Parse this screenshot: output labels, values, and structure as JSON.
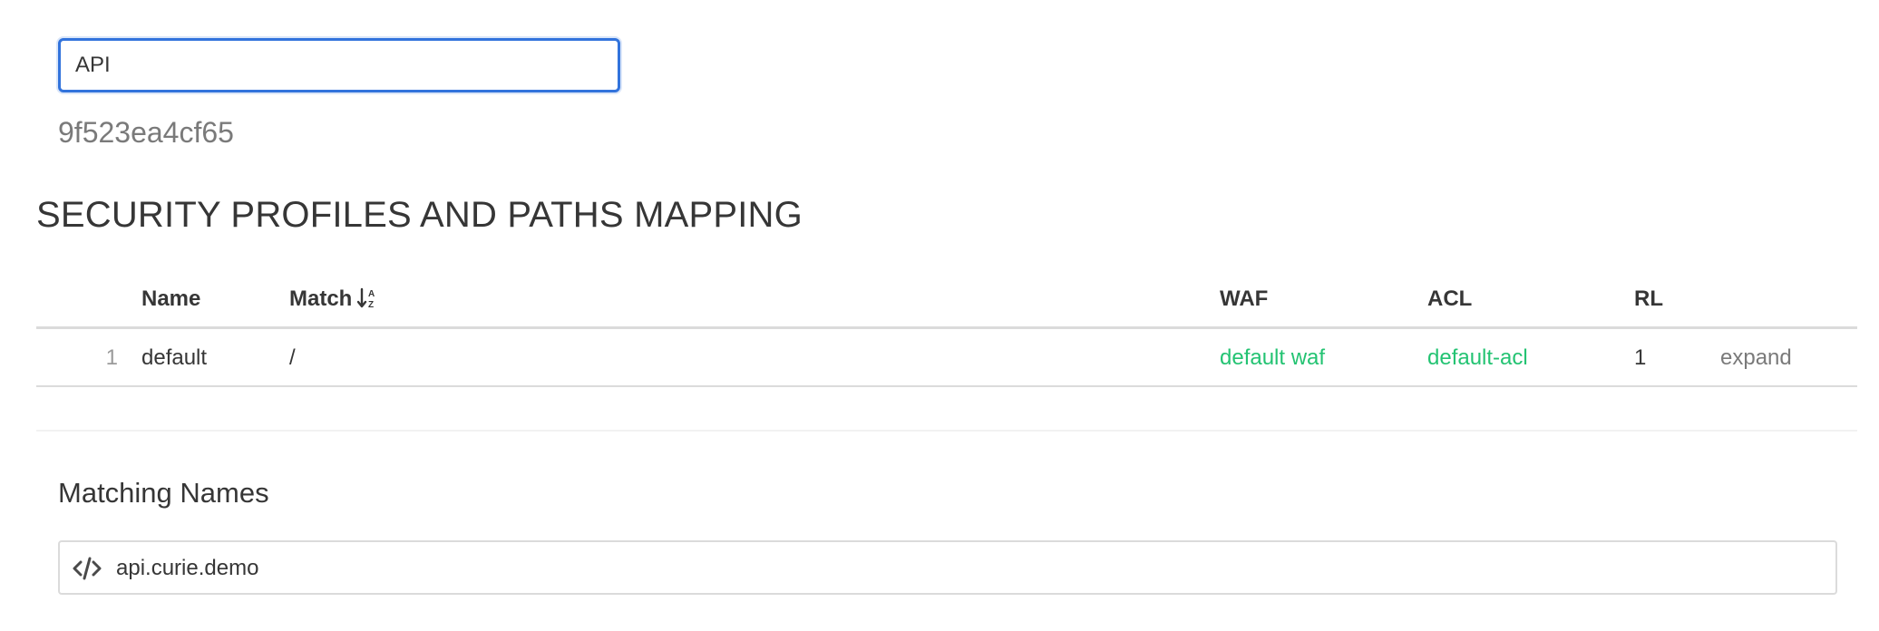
{
  "form": {
    "name_value": "API",
    "entry_id": "9f523ea4cf65"
  },
  "mapping": {
    "title": "SECURITY PROFILES AND PATHS MAPPING",
    "columns": {
      "name": "Name",
      "match": "Match",
      "waf": "WAF",
      "acl": "ACL",
      "rl": "RL"
    },
    "rows": [
      {
        "index": "1",
        "name": "default",
        "match": "/",
        "waf": "default waf",
        "acl": "default-acl",
        "rl": "1",
        "action": "expand"
      }
    ]
  },
  "matching_names": {
    "title": "Matching Names",
    "value": "api.curie.demo",
    "icon": "code-icon"
  },
  "colors": {
    "accent": "#3273dc",
    "link": "#23c372",
    "muted": "#7a7a7a"
  }
}
